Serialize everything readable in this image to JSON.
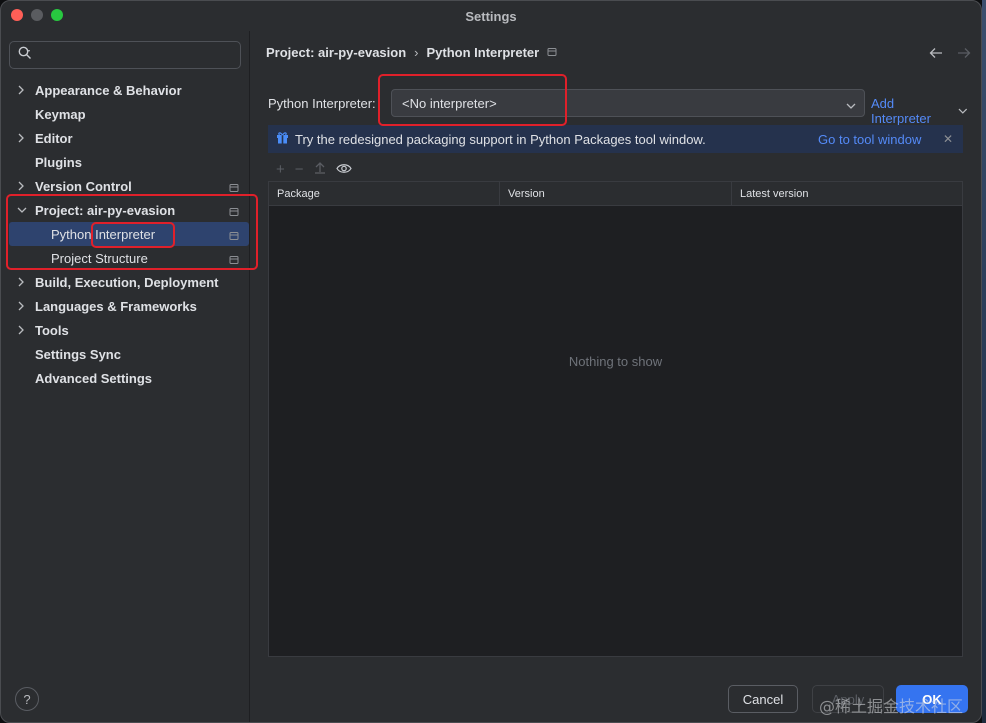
{
  "window": {
    "title": "Settings"
  },
  "sidebar": {
    "search_placeholder": "",
    "items": [
      {
        "label": "Appearance & Behavior",
        "expandable": true,
        "expanded": false,
        "pin": false
      },
      {
        "label": "Keymap",
        "expandable": false,
        "pin": false
      },
      {
        "label": "Editor",
        "expandable": true,
        "expanded": false,
        "pin": false
      },
      {
        "label": "Plugins",
        "expandable": false,
        "pin": false
      },
      {
        "label": "Version Control",
        "expandable": true,
        "expanded": false,
        "pin": true
      },
      {
        "label": "Project: air-py-evasion",
        "expandable": true,
        "expanded": true,
        "pin": true
      },
      {
        "label": "Python Interpreter",
        "child": true,
        "selected": true,
        "pin": true
      },
      {
        "label": "Project Structure",
        "child": true,
        "pin": true
      },
      {
        "label": "Build, Execution, Deployment",
        "expandable": true,
        "expanded": false,
        "pin": false
      },
      {
        "label": "Languages & Frameworks",
        "expandable": true,
        "expanded": false,
        "pin": false
      },
      {
        "label": "Tools",
        "expandable": true,
        "expanded": false,
        "pin": false
      },
      {
        "label": "Settings Sync",
        "expandable": false,
        "pin": false
      },
      {
        "label": "Advanced Settings",
        "expandable": false,
        "pin": false
      }
    ],
    "help_label": "?"
  },
  "main": {
    "breadcrumb": {
      "project": "Project: air-py-evasion",
      "separator": "›",
      "page": "Python Interpreter"
    },
    "interpreter": {
      "label": "Python Interpreter:",
      "value": "<No interpreter>",
      "add_label": "Add Interpreter"
    },
    "banner": {
      "text": "Try the redesigned packaging support in Python Packages tool window.",
      "link": "Go to tool window",
      "close": "✕"
    },
    "table": {
      "columns": [
        "Package",
        "Version",
        "Latest version"
      ],
      "empty_text": "Nothing to show"
    },
    "buttons": {
      "cancel": "Cancel",
      "apply": "Apply",
      "ok": "OK"
    }
  },
  "watermark": "@稀土掘金技术社区",
  "colors": {
    "accent": "#3574f0",
    "link": "#548af7",
    "highlight": "#e0202a",
    "selection": "#2e436e"
  }
}
